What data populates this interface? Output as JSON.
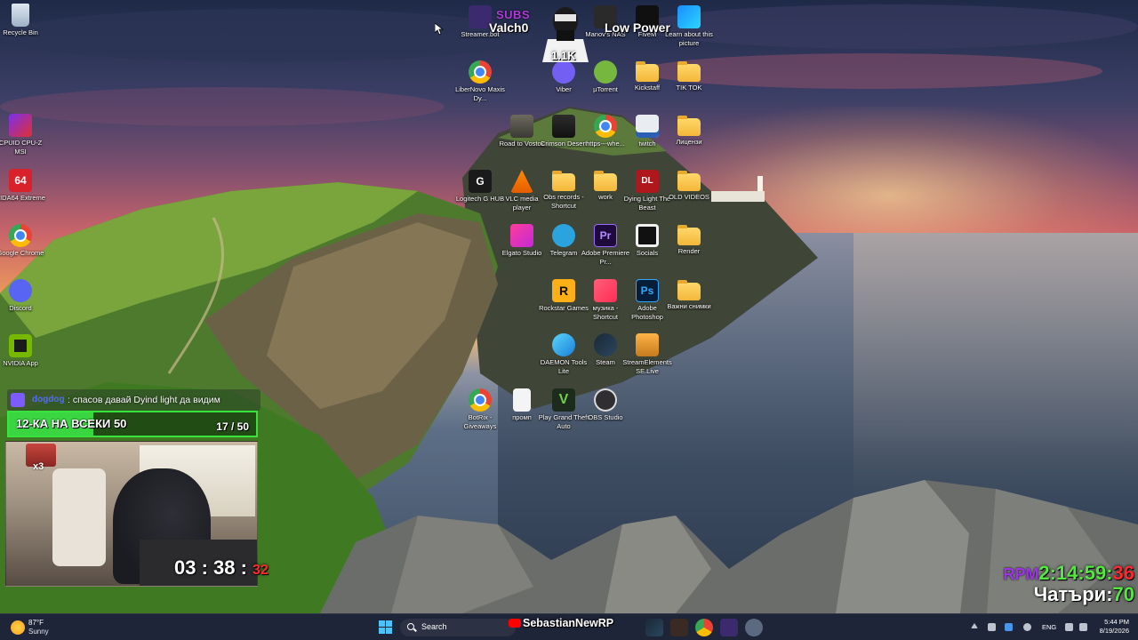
{
  "desktop": {
    "left_column": [
      {
        "label": "Recycle Bin",
        "icon": "recycle-bin-icon"
      },
      {
        "label": "CPUID CPU-Z MSI",
        "icon": "cpuz-icon"
      },
      {
        "label": "AIDA64 Extreme",
        "icon": "aida64-icon",
        "glyph_text": "64"
      },
      {
        "label": "Google Chrome",
        "icon": "chrome-icon"
      },
      {
        "label": "Discord",
        "icon": "discord-icon"
      },
      {
        "label": "NVIDIA App",
        "icon": "nvidia-icon"
      }
    ],
    "grid_icons": [
      {
        "label": "Streamer.bot",
        "icon": "streamerbot-icon"
      },
      {
        "label": "Manov's NAS",
        "icon": "nas-icon"
      },
      {
        "label": "FiveM",
        "icon": "fivem-icon"
      },
      {
        "label": "Learn about this picture",
        "icon": "spotlight-icon"
      },
      {
        "label": "LiberNovo Maxis Dy...",
        "icon": "chrome-icon"
      },
      {
        "label": "Viber",
        "icon": "viber-icon"
      },
      {
        "label": "µTorrent",
        "icon": "utorrent-icon"
      },
      {
        "label": "Kickstaff",
        "icon": "folder-icon"
      },
      {
        "label": "TIK TOK",
        "icon": "folder-icon"
      },
      {
        "label": "Road to Vostok",
        "icon": "road-to-vostok-icon"
      },
      {
        "label": "Crimson Desert",
        "icon": "crimson-desert-icon"
      },
      {
        "label": "https---whe...",
        "icon": "chrome-icon"
      },
      {
        "label": "twitch",
        "icon": "twitch-icon"
      },
      {
        "label": "Лицензи",
        "icon": "folder-icon"
      },
      {
        "label": "Logitech G HUB",
        "icon": "logitech-icon",
        "glyph_text": "G"
      },
      {
        "label": "VLC media player",
        "icon": "vlc-icon"
      },
      {
        "label": "Obs records - Shortcut",
        "icon": "folder-icon"
      },
      {
        "label": "work",
        "icon": "folder-icon"
      },
      {
        "label": "Dying Light The Beast",
        "icon": "dying-light-icon",
        "glyph_text": "DL"
      },
      {
        "label": "OLD VIDEOS",
        "icon": "folder-icon"
      },
      {
        "label": "Elgato Studio",
        "icon": "elgato-icon"
      },
      {
        "label": "Telegram",
        "icon": "telegram-icon"
      },
      {
        "label": "Adobe Premiere Pr...",
        "icon": "premiere-icon",
        "glyph_text": "Pr"
      },
      {
        "label": "Socials",
        "icon": "socials-icon"
      },
      {
        "label": "Render",
        "icon": "folder-icon"
      },
      {
        "label": "Rockstar Games",
        "icon": "rockstar-icon",
        "glyph_text": "R"
      },
      {
        "label": "музика - Shortcut",
        "icon": "music-icon"
      },
      {
        "label": "Adobe Photoshop",
        "icon": "photoshop-icon",
        "glyph_text": "Ps"
      },
      {
        "label": "Важни снимки",
        "icon": "folder-icon"
      },
      {
        "label": "DAEMON Tools Lite",
        "icon": "daemon-tools-icon"
      },
      {
        "label": "Steam",
        "icon": "steam-icon"
      },
      {
        "label": "StreamElements SE.Live",
        "icon": "streamelements-icon"
      },
      {
        "label": "BotRix - Giveaways",
        "icon": "chrome-icon"
      },
      {
        "label": "промп",
        "icon": "document-icon"
      },
      {
        "label": "Play Grand Theft Auto",
        "icon": "gta-icon",
        "glyph_text": "V"
      },
      {
        "label": "OBS Studio",
        "icon": "obs-icon"
      }
    ]
  },
  "overlays": {
    "subs_label": "SUBS",
    "sub_name": "Valch0",
    "mascot_count": "1.1K",
    "low_power": "Low Power",
    "chat_user": "dogdog",
    "chat_message": ": спасов давай Dyind light да видим",
    "goal_title": "12-КА НА ВСЕКИ 50",
    "goal_count": "17 / 50",
    "goal_progress": 0.34,
    "cam_multiplier": "x3",
    "timer_main": "03 : 38 : ",
    "timer_red": "32",
    "rpm_label": "RPM",
    "rpm_time": "2:14:59:",
    "rpm_secs": "36",
    "chat_label": "Чатъри:",
    "chat_count": "70"
  },
  "taskbar": {
    "weather_temp": "87°F",
    "weather_cond": "Sunny",
    "search_label": "Search",
    "overlay_name": "SebastianNewRP",
    "lang": "ENG",
    "time": "5:44 PM",
    "date": "8/19/2026"
  },
  "colors": {
    "goal_green": "#3ad641",
    "subs_purple": "#b03ad8",
    "rpm_green": "#52e83f",
    "timer_red": "#ff2b2b"
  }
}
